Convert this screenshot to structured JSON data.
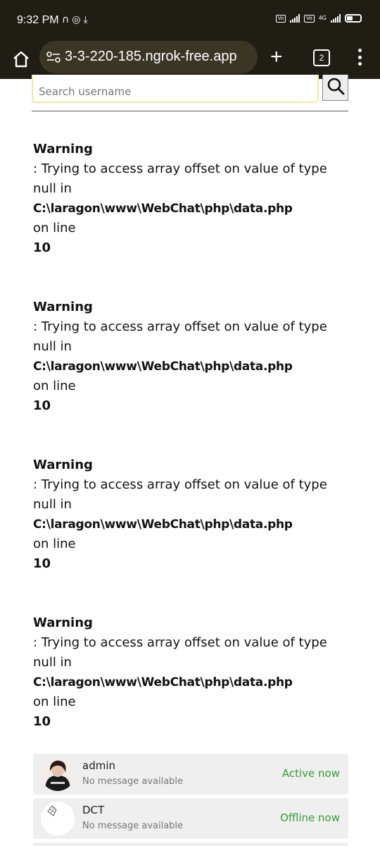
{
  "status_bar": {
    "time": "9:32 PM",
    "network": "4G"
  },
  "browser": {
    "url": "3-3-220-185.ngrok-free.app",
    "tab_count": "2"
  },
  "search": {
    "placeholder": "Search username"
  },
  "warnings": [
    {
      "title": "Warning",
      "message": ": Trying to access array offset on value of type null in",
      "path": "C:\\laragon\\www\\WebChat\\php\\data.php",
      "line_label": "on line",
      "line": "10"
    },
    {
      "title": "Warning",
      "message": ": Trying to access array offset on value of type null in",
      "path": "C:\\laragon\\www\\WebChat\\php\\data.php",
      "line_label": "on line",
      "line": "10"
    },
    {
      "title": "Warning",
      "message": ": Trying to access array offset on value of type null in",
      "path": "C:\\laragon\\www\\WebChat\\php\\data.php",
      "line_label": "on line",
      "line": "10"
    },
    {
      "title": "Warning",
      "message": ": Trying to access array offset on value of type null in",
      "path": "C:\\laragon\\www\\WebChat\\php\\data.php",
      "line_label": "on line",
      "line": "10"
    }
  ],
  "users": [
    {
      "name": "admin",
      "message": "No message available",
      "status": "Active now",
      "avatar": "profile-photo"
    },
    {
      "name": "DCT",
      "message": "No message available",
      "status": "Offline now",
      "avatar": "sketch-logo"
    }
  ],
  "colors": {
    "bar_bg": "#201d14",
    "status_green": "#3a9a3a",
    "search_border": "#f4e7a4"
  }
}
